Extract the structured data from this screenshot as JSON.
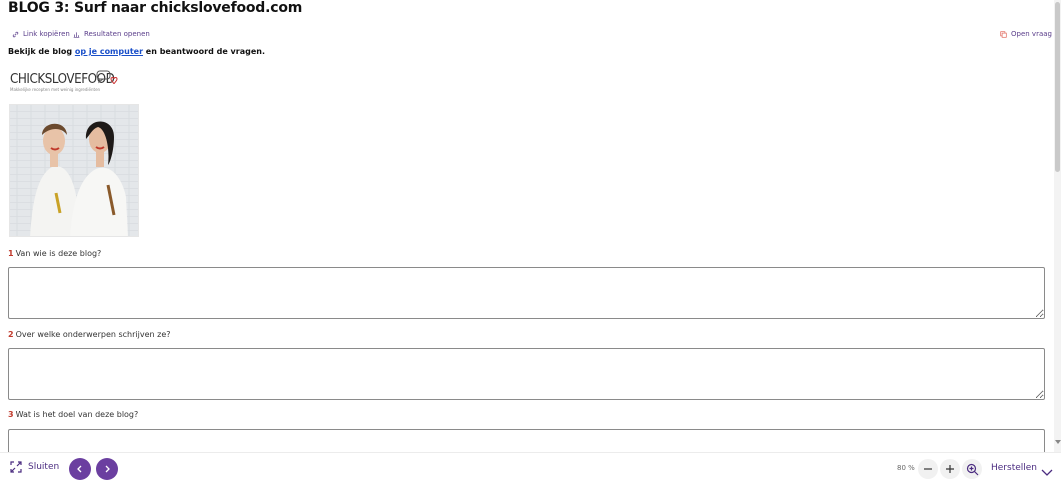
{
  "page": {
    "title": "BLOG 3: Surf naar chickslovefood.com"
  },
  "toolbar": {
    "copy_link_label": "Link kopiëren",
    "open_results_label": "Resultaten openen",
    "open_question_label": "Open vraag"
  },
  "instruction": {
    "before": "Bekijk de blog ",
    "link": "op je computer",
    "after": " en beantwoord de vragen."
  },
  "logo": {
    "text": "CHICKSLOVEFOOD",
    "tagline": "Makkelijke recepten met weinig ingrediënten"
  },
  "questions": [
    {
      "number": "1",
      "text": "Van wie is deze blog?",
      "answer": ""
    },
    {
      "number": "2",
      "text": "Over welke onderwerpen schrijven ze?",
      "answer": ""
    },
    {
      "number": "3",
      "text": "Wat is het doel van deze blog?",
      "answer": ""
    }
  ],
  "footer": {
    "close_label": "Sluiten",
    "zoom_level": "80 %",
    "reset_label": "Herstellen"
  },
  "colors": {
    "accent": "#6b3fa0",
    "link": "#1a4fc9",
    "question_number": "#c0392b"
  }
}
